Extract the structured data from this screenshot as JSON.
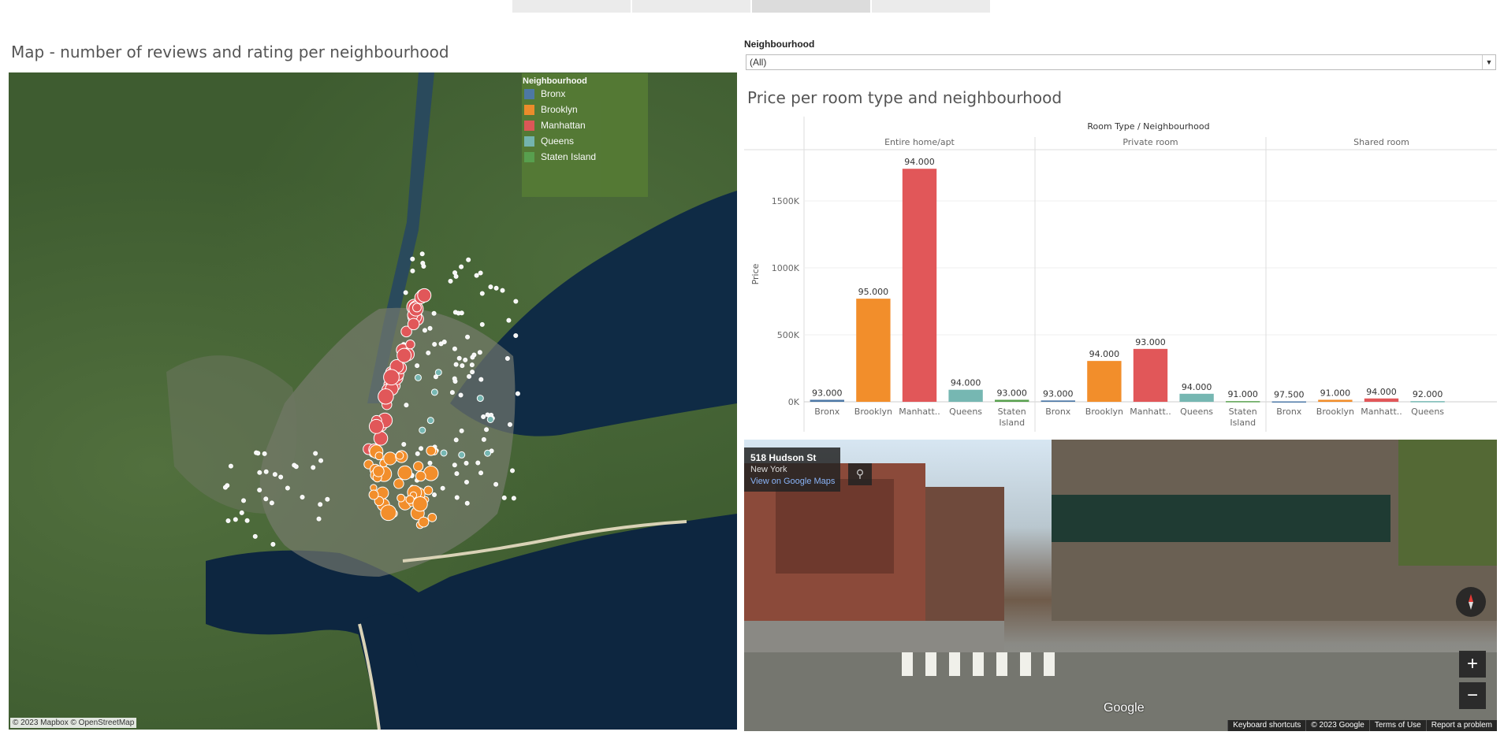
{
  "map": {
    "title": "Map - number of reviews and rating per neighbourhood",
    "legend_title": "Neighbourhood",
    "legend": [
      {
        "label": "Bronx",
        "color": "#4e79a7"
      },
      {
        "label": "Brooklyn",
        "color": "#f28e2b"
      },
      {
        "label": "Manhattan",
        "color": "#e15759"
      },
      {
        "label": "Queens",
        "color": "#76b7b2"
      },
      {
        "label": "Staten Island",
        "color": "#59a14f"
      }
    ],
    "attribution": "© 2023 Mapbox © OpenStreetMap"
  },
  "filter": {
    "label": "Neighbourhood",
    "value": "(All)"
  },
  "chart": {
    "title": "Price per room type and neighbourhood"
  },
  "chart_data": {
    "type": "bar",
    "header": "Room Type / Neighbourhood",
    "ylabel": "Price",
    "y_ticks": [
      "0K",
      "500K",
      "1000K",
      "1500K"
    ],
    "ylim": [
      0,
      1800000
    ],
    "grid": true,
    "groups": [
      {
        "name": "Entire home/apt",
        "bars": [
          {
            "category": "Bronx",
            "value": 15000,
            "label": "93.000",
            "color": "#4e79a7"
          },
          {
            "category": "Brooklyn",
            "value": 770000,
            "label": "95.000",
            "color": "#f28e2b"
          },
          {
            "category": "Manhatt..",
            "value": 1740000,
            "label": "94.000",
            "color": "#e15759"
          },
          {
            "category": "Queens",
            "value": 90000,
            "label": "94.000",
            "color": "#76b7b2"
          },
          {
            "category": "Staten Island",
            "value": 15000,
            "label": "93.000",
            "color": "#59a14f"
          }
        ]
      },
      {
        "name": "Private room",
        "bars": [
          {
            "category": "Bronx",
            "value": 10000,
            "label": "93.000",
            "color": "#4e79a7"
          },
          {
            "category": "Brooklyn",
            "value": 305000,
            "label": "94.000",
            "color": "#f28e2b"
          },
          {
            "category": "Manhatt..",
            "value": 395000,
            "label": "93.000",
            "color": "#e15759"
          },
          {
            "category": "Queens",
            "value": 60000,
            "label": "94.000",
            "color": "#76b7b2"
          },
          {
            "category": "Staten Island",
            "value": 5000,
            "label": "91.000",
            "color": "#59a14f"
          }
        ]
      },
      {
        "name": "Shared room",
        "bars": [
          {
            "category": "Bronx",
            "value": 3000,
            "label": "97.500",
            "color": "#4e79a7"
          },
          {
            "category": "Brooklyn",
            "value": 15000,
            "label": "91.000",
            "color": "#f28e2b"
          },
          {
            "category": "Manhatt..",
            "value": 25000,
            "label": "94.000",
            "color": "#e15759"
          },
          {
            "category": "Queens",
            "value": 5000,
            "label": "92.000",
            "color": "#76b7b2"
          }
        ]
      }
    ]
  },
  "streetview": {
    "address": "518 Hudson St",
    "city": "New York",
    "link": "View on Google Maps",
    "google_logo": "Google",
    "zoom_in": "+",
    "zoom_out": "−",
    "footer": [
      "Keyboard shortcuts",
      "© 2023 Google",
      "Terms of Use",
      "Report a problem"
    ]
  }
}
